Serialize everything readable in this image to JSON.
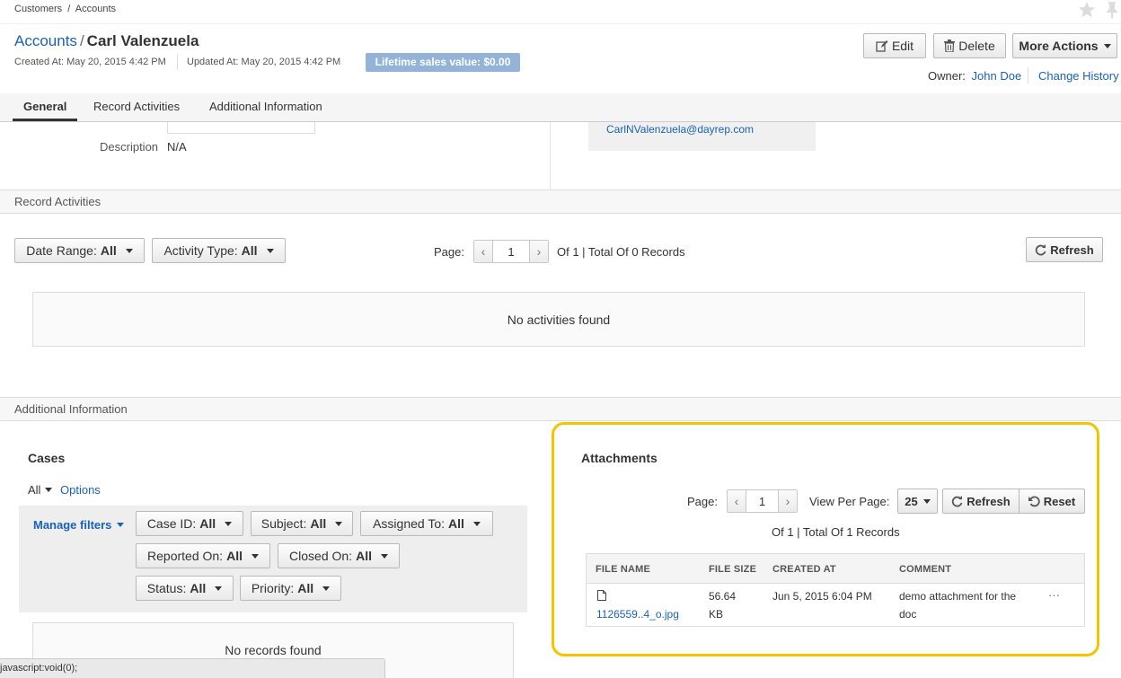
{
  "breadcrumb": {
    "part1": "Customers",
    "sep": "/",
    "part2": "Accounts"
  },
  "header": {
    "parent_link": "Accounts",
    "slash": "/",
    "record_name": "Carl Valenzuela",
    "created": "Created At: May 20, 2015 4:42 PM",
    "updated": "Updated At: May 20, 2015 4:42 PM",
    "lifetime": "Lifetime sales value: $0.00",
    "owner_label": "Owner:",
    "owner_name": "John Doe",
    "change_history": "Change History"
  },
  "actions": {
    "edit": "Edit",
    "delete": "Delete",
    "more": "More Actions"
  },
  "tabs": [
    {
      "label": "General"
    },
    {
      "label": "Record Activities"
    },
    {
      "label": "Additional Information"
    }
  ],
  "general": {
    "description_label": "Description",
    "description_value": "N/A",
    "email": "CarlNValenzuela@dayrep.com"
  },
  "record_activities": {
    "title": "Record Activities",
    "date_range_label": "Date Range:",
    "date_range_value": "All",
    "activity_type_label": "Activity Type:",
    "activity_type_value": "All",
    "page_label": "Page:",
    "page_value": "1",
    "page_summary": "Of 1 | Total Of 0 Records",
    "refresh": "Refresh",
    "empty": "No activities found"
  },
  "additional_info": {
    "title": "Additional Information"
  },
  "cases": {
    "title": "Cases",
    "all": "All",
    "options": "Options",
    "manage_filters": "Manage filters",
    "filters": [
      {
        "label": "Case ID:",
        "value": "All"
      },
      {
        "label": "Subject:",
        "value": "All"
      },
      {
        "label": "Assigned To:",
        "value": "All"
      },
      {
        "label": "Reported On:",
        "value": "All"
      },
      {
        "label": "Closed On:",
        "value": "All"
      },
      {
        "label": "Status:",
        "value": "All"
      },
      {
        "label": "Priority:",
        "value": "All"
      }
    ],
    "empty": "No records found"
  },
  "attachments": {
    "title": "Attachments",
    "page_label": "Page:",
    "page_value": "1",
    "view_per_page_label": "View Per Page:",
    "view_per_page_value": "25",
    "refresh": "Refresh",
    "reset": "Reset",
    "summary": "Of 1 | Total Of 1 Records",
    "columns": [
      "FILE NAME",
      "FILE SIZE",
      "CREATED AT",
      "COMMENT"
    ],
    "rows": [
      {
        "file_name": "1126559..4_o.jpg",
        "size_line1": "56.64",
        "size_line2": "KB",
        "created": "Jun 5, 2015 6:04 PM",
        "comment_line1": "demo attachment for the",
        "comment_line2": "doc",
        "more": "···"
      }
    ]
  },
  "status_bar": {
    "text": "javascript:void(0);"
  },
  "colors": {
    "link": "#1a62b8",
    "highlight": "#f5c400",
    "badge": "#93b4d8"
  }
}
